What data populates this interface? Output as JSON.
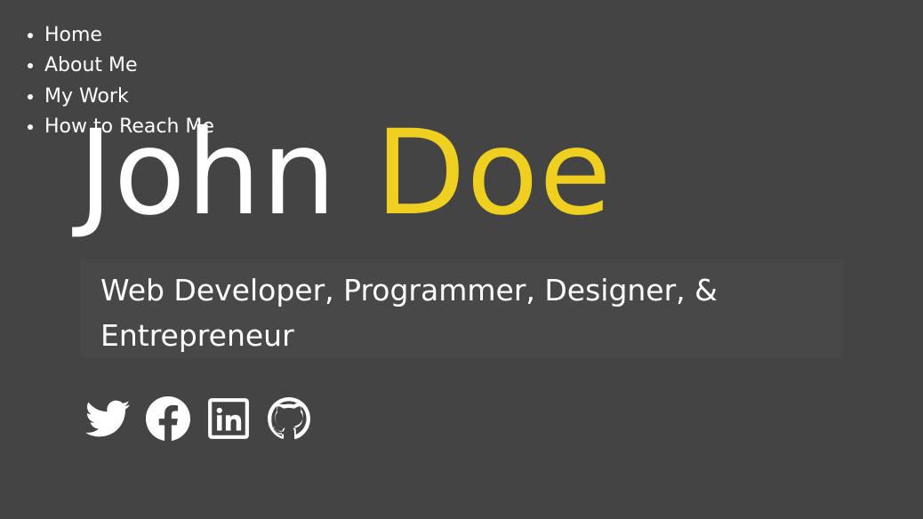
{
  "nav": {
    "items": [
      {
        "label": "Home"
      },
      {
        "label": "About Me"
      },
      {
        "label": "My Work"
      },
      {
        "label": "How to Reach Me"
      }
    ]
  },
  "hero": {
    "first_name": "John",
    "last_name": "Doe",
    "tagline": "Web Developer, Programmer, Designer, & Entrepreneur"
  },
  "social": {
    "icons": [
      "twitter-icon",
      "facebook-icon",
      "linkedin-icon",
      "github-icon"
    ]
  },
  "colors": {
    "background": "#444444",
    "accent": "#efcf1f",
    "text": "#ffffff",
    "tagline_box": "#484848"
  }
}
